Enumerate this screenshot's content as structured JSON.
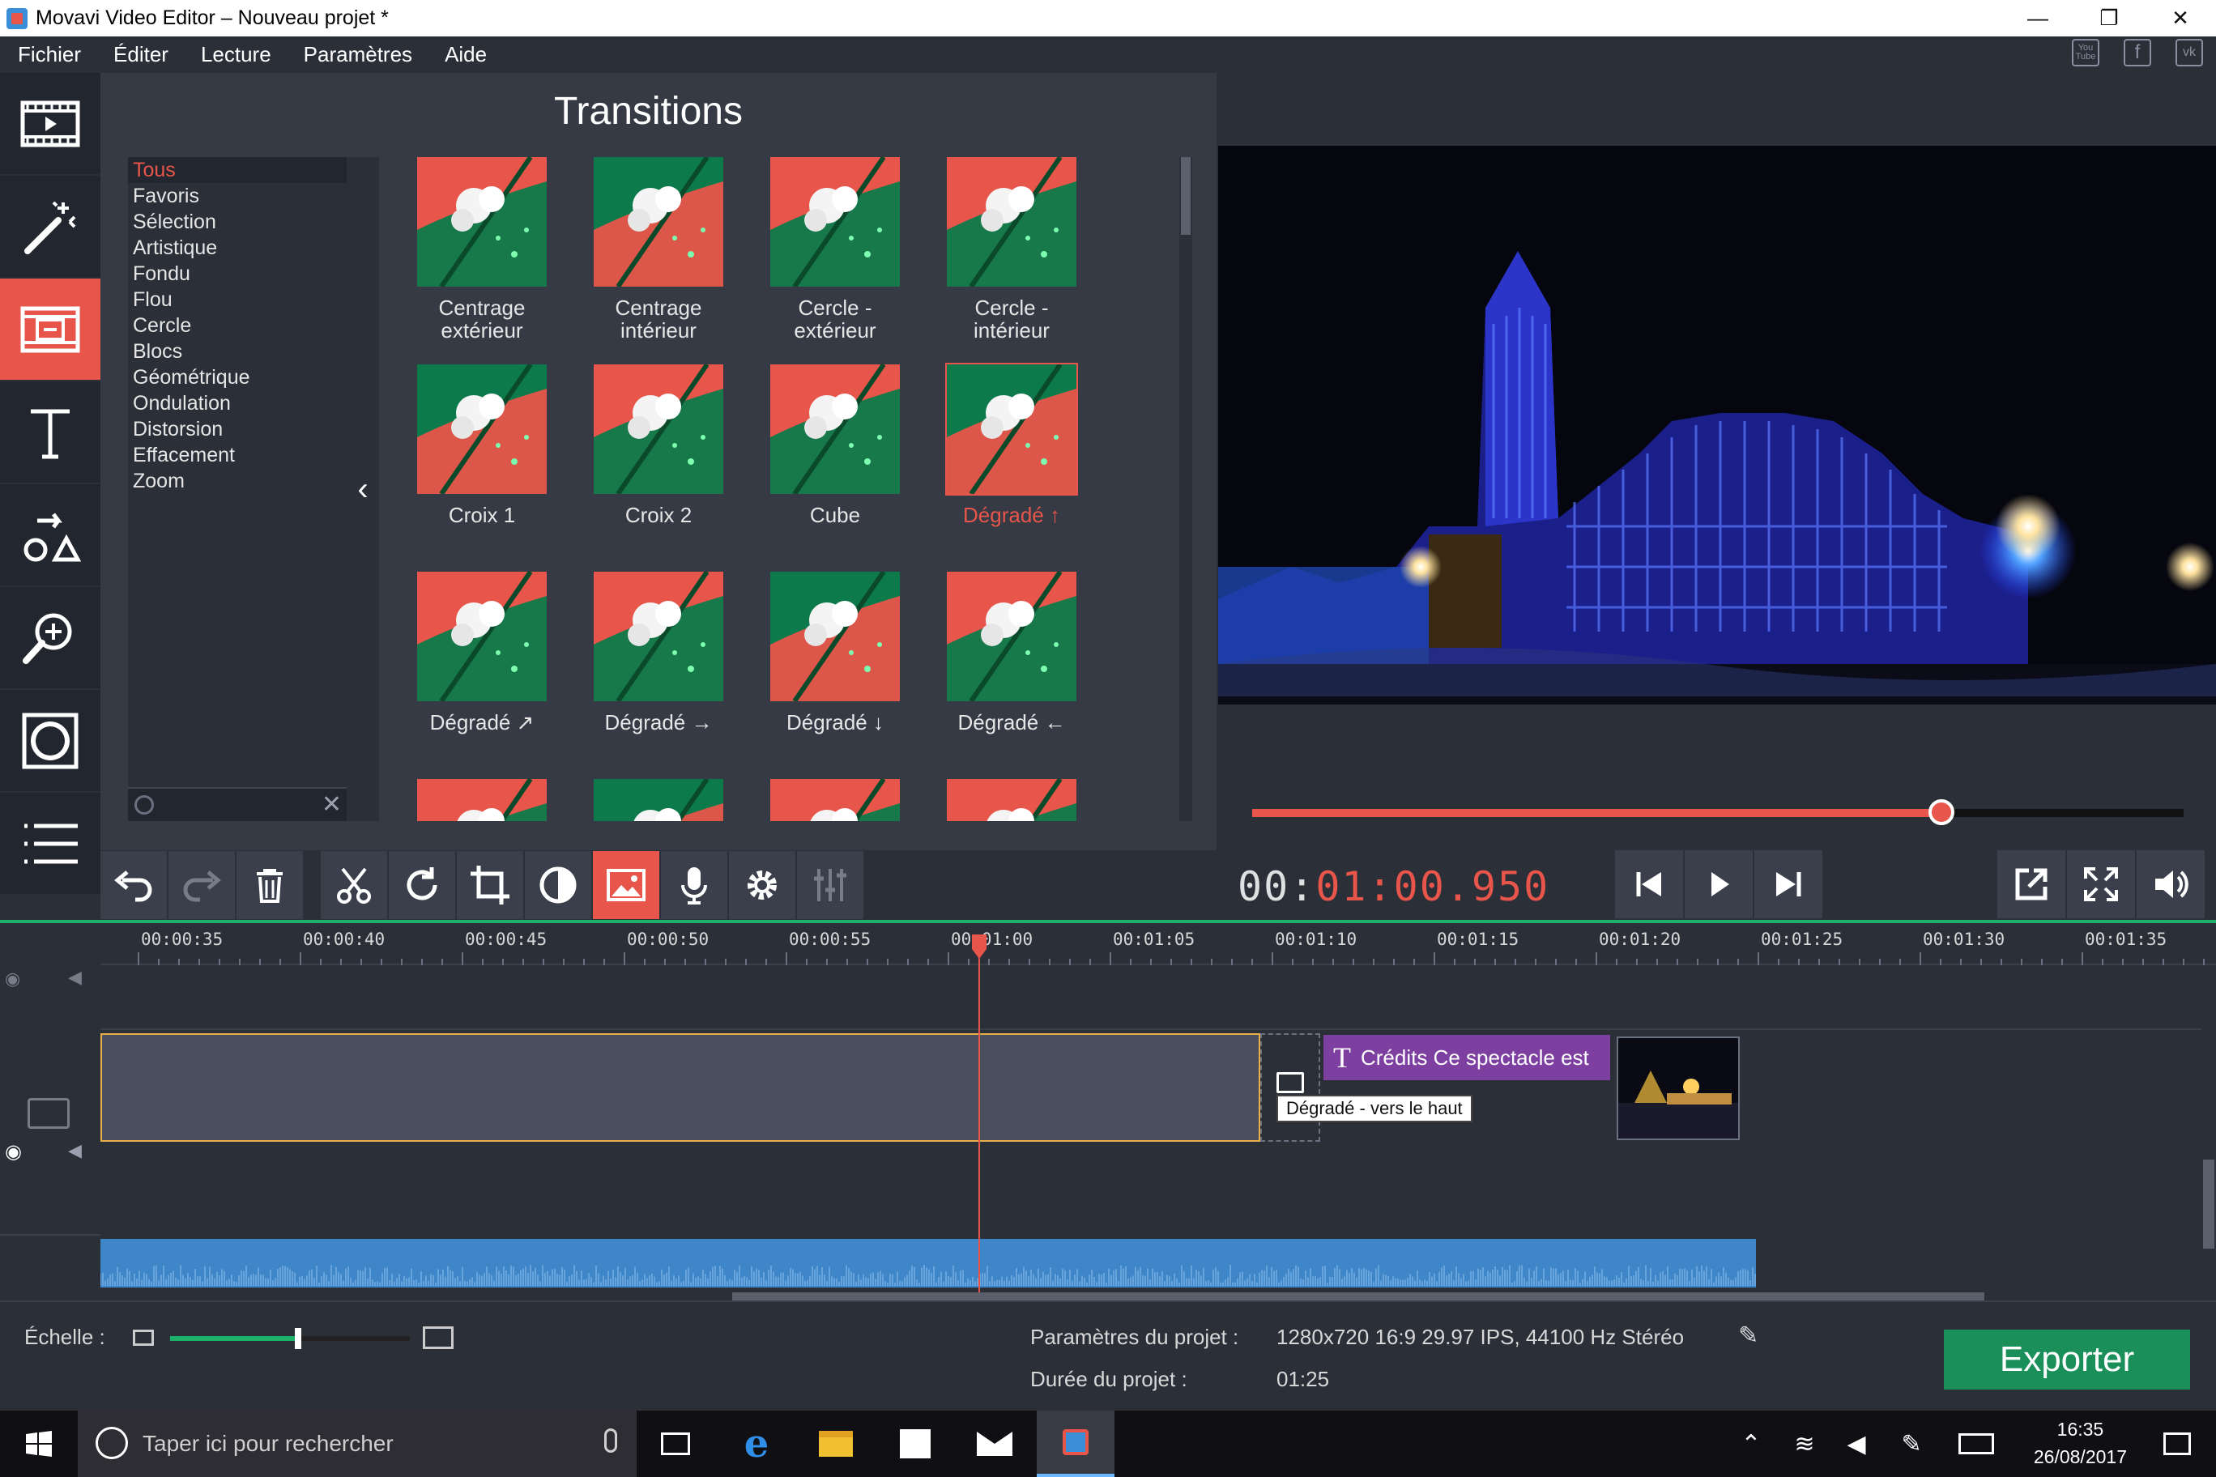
{
  "window": {
    "title": "Movavi Video Editor – Nouveau projet *",
    "controls": [
      "—",
      "❐",
      "✕"
    ]
  },
  "menu": [
    "Fichier",
    "Éditer",
    "Lecture",
    "Paramètres",
    "Aide"
  ],
  "social": [
    "You\nTube",
    "f",
    "vk"
  ],
  "tools": [
    {
      "name": "import-media-icon"
    },
    {
      "name": "magic-wand-icon"
    },
    {
      "name": "transitions-icon",
      "active": true
    },
    {
      "name": "titles-icon"
    },
    {
      "name": "callouts-icon"
    },
    {
      "name": "zoom-icon"
    },
    {
      "name": "filters-icon"
    },
    {
      "name": "more-tools-icon"
    }
  ],
  "transitions": {
    "title": "Transitions",
    "categories": [
      "Tous",
      "Favoris",
      "Sélection",
      "Artistique",
      "Fondu",
      "Flou",
      "Cercle",
      "Blocs",
      "Géométrique",
      "Ondulation",
      "Distorsion",
      "Effacement",
      "Zoom"
    ],
    "selected_category": "Tous",
    "items": [
      {
        "label": "Centrage\nextérieur"
      },
      {
        "label": "Centrage\nintérieur"
      },
      {
        "label": "Cercle -\nextérieur"
      },
      {
        "label": "Cercle -\nintérieur"
      },
      {
        "label": "Croix 1"
      },
      {
        "label": "Croix 2"
      },
      {
        "label": "Cube"
      },
      {
        "label": "Dégradé ↑",
        "selected": true
      },
      {
        "label": "Dégradé ↗"
      },
      {
        "label": "Dégradé →"
      },
      {
        "label": "Dégradé ↓"
      },
      {
        "label": "Dégradé ←"
      },
      {
        "label": ""
      },
      {
        "label": ""
      },
      {
        "label": ""
      },
      {
        "label": ""
      }
    ],
    "collapse_glyph": "‹",
    "search_clear": "✕"
  },
  "player": {
    "timecode_prefix": "00:",
    "timecode_main": "01:00.950",
    "progress": 0.74
  },
  "timeline": {
    "ticks": [
      "00:00:35",
      "00:00:40",
      "00:00:45",
      "00:00:50",
      "00:00:55",
      "00:01:00",
      "00:01:05",
      "00:01:10",
      "00:01:15",
      "00:01:20",
      "00:01:25",
      "00:01:30",
      "00:01:35"
    ],
    "title_clip": "Crédits Ce spectacle est",
    "transition_tooltip": "Dégradé - vers le haut"
  },
  "bottom": {
    "scale_label": "Échelle :",
    "scale_level": 0.52,
    "params_label": "Paramètres du projet :",
    "params_value": "1280x720 16:9 29.97 IPS, 44100 Hz Stéréo",
    "duration_label": "Durée du projet :",
    "duration_value": "01:25",
    "export_label": "Exporter"
  },
  "taskbar": {
    "search_placeholder": "Taper ici pour rechercher",
    "time": "16:35",
    "date": "26/08/2017"
  },
  "colors": {
    "accent": "#e8554a",
    "green": "#1db06a",
    "title_clip": "#7d3fa0",
    "audio": "#3f86c8"
  }
}
